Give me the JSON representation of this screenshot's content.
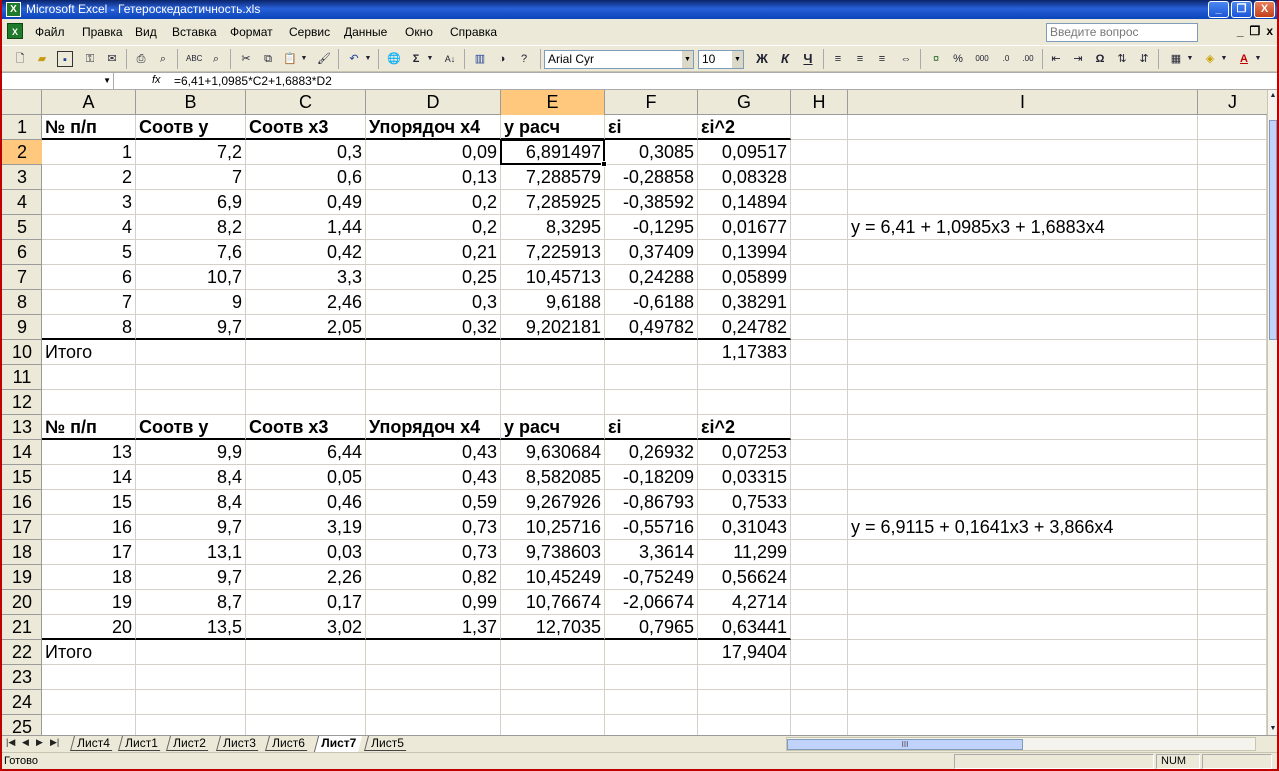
{
  "window": {
    "title": "Microsoft Excel - Гетероскедастичность.xls",
    "app_icon": "excel-icon",
    "minimize": "_",
    "restore": "❐",
    "close": "X"
  },
  "menu": {
    "items": [
      "Файл",
      "Правка",
      "Вид",
      "Вставка",
      "Формат",
      "Сервис",
      "Данные",
      "Окно",
      "Справка"
    ],
    "help_placeholder": "Введите вопрос",
    "doc_controls": [
      "_",
      "❐",
      "x"
    ]
  },
  "toolbar": {
    "font_name": "Arial Cyr",
    "font_size": "10",
    "bold": "Ж",
    "italic": "К",
    "underline": "Ч",
    "percent": "%",
    "thousands": "000"
  },
  "formula_bar": {
    "name_box": "",
    "fx": "fx",
    "formula": "=6,41+1,0985*C2+1,6883*D2"
  },
  "sheet": {
    "active_cell": "E2",
    "columns": [
      "A",
      "B",
      "C",
      "D",
      "E",
      "F",
      "G",
      "H",
      "I",
      "J"
    ],
    "rows": [
      "1",
      "2",
      "3",
      "4",
      "5",
      "6",
      "7",
      "8",
      "9",
      "10",
      "11",
      "12",
      "13",
      "14",
      "15",
      "16",
      "17",
      "18",
      "19",
      "20",
      "21",
      "22",
      "23",
      "24",
      "25"
    ],
    "headers": [
      "№ п/п",
      "Соотв y",
      "Соотв x3",
      "Упорядоч x4",
      "y расч",
      "εi",
      "εi^2"
    ],
    "table1": [
      [
        "1",
        "7,2",
        "0,3",
        "0,09",
        "6,891497",
        "0,3085",
        "0,09517"
      ],
      [
        "2",
        "7",
        "0,6",
        "0,13",
        "7,288579",
        "-0,28858",
        "0,08328"
      ],
      [
        "3",
        "6,9",
        "0,49",
        "0,2",
        "7,285925",
        "-0,38592",
        "0,14894"
      ],
      [
        "4",
        "8,2",
        "1,44",
        "0,2",
        "8,3295",
        "-0,1295",
        "0,01677"
      ],
      [
        "5",
        "7,6",
        "0,42",
        "0,21",
        "7,225913",
        "0,37409",
        "0,13994"
      ],
      [
        "6",
        "10,7",
        "3,3",
        "0,25",
        "10,45713",
        "0,24288",
        "0,05899"
      ],
      [
        "7",
        "9",
        "2,46",
        "0,3",
        "9,6188",
        "-0,6188",
        "0,38291"
      ],
      [
        "8",
        "9,7",
        "2,05",
        "0,32",
        "9,202181",
        "0,49782",
        "0,24782"
      ]
    ],
    "table1_total_label": "Итого",
    "table1_total": "1,17383",
    "table2": [
      [
        "13",
        "9,9",
        "6,44",
        "0,43",
        "9,630684",
        "0,26932",
        "0,07253"
      ],
      [
        "14",
        "8,4",
        "0,05",
        "0,43",
        "8,582085",
        "-0,18209",
        "0,03315"
      ],
      [
        "15",
        "8,4",
        "0,46",
        "0,59",
        "9,267926",
        "-0,86793",
        "0,7533"
      ],
      [
        "16",
        "9,7",
        "3,19",
        "0,73",
        "10,25716",
        "-0,55716",
        "0,31043"
      ],
      [
        "17",
        "13,1",
        "0,03",
        "0,73",
        "9,738603",
        "3,3614",
        "11,299"
      ],
      [
        "18",
        "9,7",
        "2,26",
        "0,82",
        "10,45249",
        "-0,75249",
        "0,56624"
      ],
      [
        "19",
        "8,7",
        "0,17",
        "0,99",
        "10,76674",
        "-2,06674",
        "4,2714"
      ],
      [
        "20",
        "13,5",
        "3,02",
        "1,37",
        "12,7035",
        "0,7965",
        "0,63441"
      ]
    ],
    "table2_total_label": "Итого",
    "table2_total": "17,9404",
    "equation1": "y = 6,41 + 1,0985x3 + 1,6883x4",
    "equation2": "y = 6,9115 + 0,1641x3 + 3,866x4"
  },
  "tabs": {
    "items": [
      "Лист4",
      "Лист1",
      "Лист2",
      "Лист3",
      "Лист6",
      "Лист7",
      "Лист5"
    ],
    "active": "Лист7"
  },
  "status": {
    "text": "Готово",
    "num": "NUM"
  },
  "colors": {
    "title_bar": "#0a246a",
    "selected_header": "#ffc87c",
    "chrome": "#ece9d8",
    "frame": "#c00000"
  }
}
